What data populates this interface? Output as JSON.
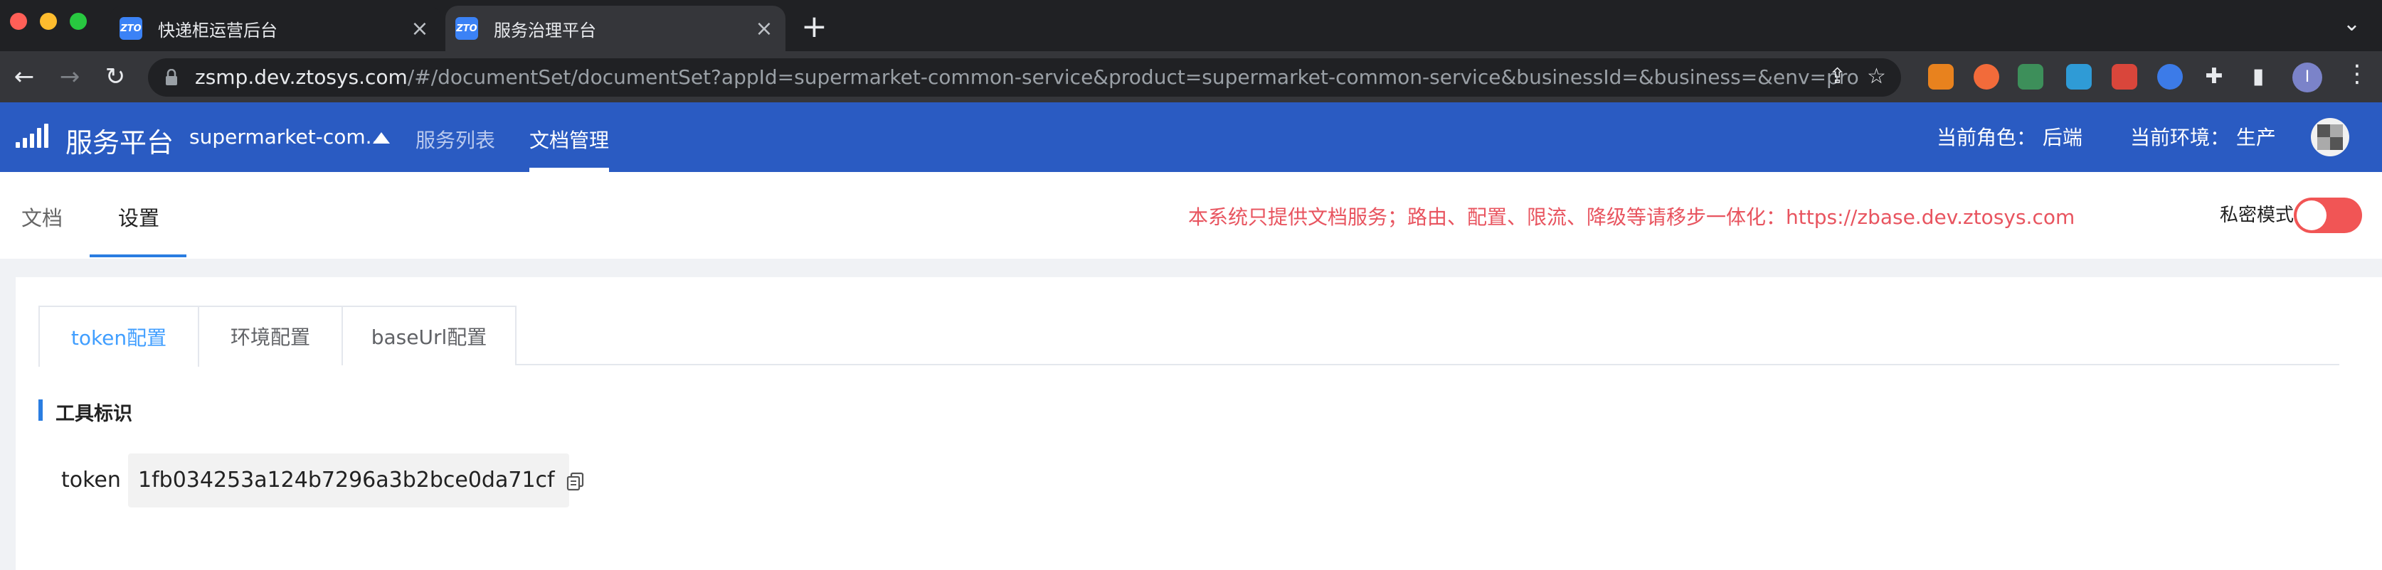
{
  "browser": {
    "tabs": [
      {
        "title": "快递柜运营后台",
        "favicon": "ZTO",
        "active": false
      },
      {
        "title": "服务治理平台",
        "favicon": "ZTO",
        "active": true
      }
    ],
    "new_tab": "+",
    "url_host": "zsmp.dev.ztosys.com",
    "url_path": "/#/documentSet/documentSet?appId=supermarket-common-service&product=supermarket-common-service&businessId=&business=&env=pro",
    "profile_initial": "I",
    "colors": {
      "frame": "#202124",
      "toolbar": "#35363a"
    }
  },
  "app": {
    "brand": "服务平台",
    "service": "supermarket-com...",
    "nav": [
      {
        "label": "服务列表",
        "active": false
      },
      {
        "label": "文档管理",
        "active": true
      }
    ],
    "role_label": "当前角色：",
    "role_value": "后端",
    "env_label": "当前环境：",
    "env_value": "生产",
    "colors": {
      "header": "#2a5bc2",
      "accent": "#2a7de1",
      "warning": "#e8545f"
    }
  },
  "subnav": {
    "tabs": [
      {
        "label": "文档",
        "active": false
      },
      {
        "label": "设置",
        "active": true
      }
    ],
    "notice": "本系统只提供文档服务；路由、配置、限流、降级等请移步一体化：https://zbase.dev.ztosys.com",
    "private_mode_label": "私密模式",
    "private_mode_on": true
  },
  "settings": {
    "tabs": [
      {
        "label": "token配置",
        "active": true
      },
      {
        "label": "环境配置",
        "active": false
      },
      {
        "label": "baseUrl配置",
        "active": false
      }
    ],
    "section_title": "工具标识",
    "token_label": "token",
    "token_value": "1fb034253a124b7296a3b2bce0da71cf"
  }
}
